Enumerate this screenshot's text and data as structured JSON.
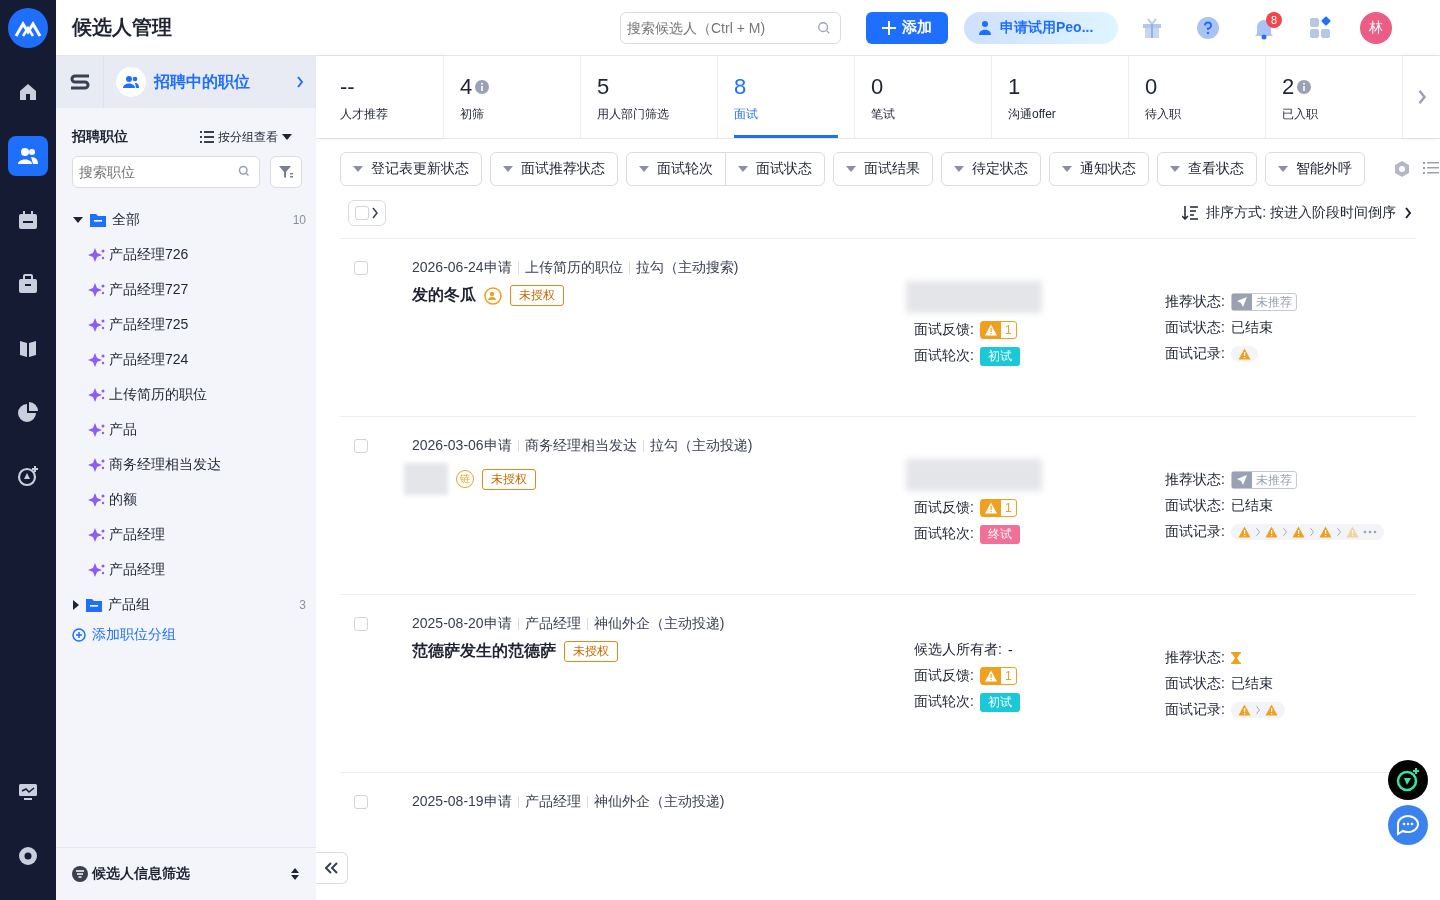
{
  "header": {
    "title": "候选人管理",
    "search": {
      "placeholder": "搜索候选人（Ctrl + M)"
    },
    "add_button": "添加",
    "trial_button": "申请试用Peo...",
    "notifications_badge": "8",
    "avatar": "林"
  },
  "nav": [
    {
      "selected": false
    },
    {
      "selected": true
    },
    {
      "selected": false
    },
    {
      "selected": false
    },
    {
      "selected": false
    },
    {
      "selected": false
    },
    {
      "selected": false
    }
  ],
  "sidebar": {
    "view_title": "招聘中的职位",
    "section_title": "招聘职位",
    "view_mode": "按分组查看",
    "search": {
      "placeholder": "搜索职位"
    },
    "groups": [
      {
        "label": "全部",
        "count": "10",
        "expanded": true,
        "children": [
          {
            "label": "产品经理726"
          },
          {
            "label": "产品经理727"
          },
          {
            "label": "产品经理725"
          },
          {
            "label": "产品经理724"
          },
          {
            "label": "上传简历的职位"
          },
          {
            "label": "产品"
          },
          {
            "label": "商务经理相当发达"
          },
          {
            "label": "的额"
          },
          {
            "label": "产品经理"
          },
          {
            "label": "产品经理"
          }
        ]
      },
      {
        "label": "产品组",
        "count": "3",
        "expanded": false
      }
    ],
    "add_group": "添加职位分组",
    "footer": "候选人信息筛选"
  },
  "stages": [
    {
      "count": "--",
      "label": "人才推荐",
      "info": false,
      "selected": false
    },
    {
      "count": "4",
      "label": "初筛",
      "info": true,
      "selected": false
    },
    {
      "count": "5",
      "label": "用人部门筛选",
      "info": false,
      "selected": false
    },
    {
      "count": "8",
      "label": "面试",
      "info": false,
      "selected": true
    },
    {
      "count": "0",
      "label": "笔试",
      "info": false,
      "selected": false
    },
    {
      "count": "1",
      "label": "沟通offer",
      "info": false,
      "selected": false
    },
    {
      "count": "0",
      "label": "待入职",
      "info": false,
      "selected": false
    },
    {
      "count": "2",
      "label": "已入职",
      "info": true,
      "selected": false
    }
  ],
  "filters": [
    [
      "登记表更新状态"
    ],
    [
      "面试推荐状态"
    ],
    [
      "面试轮次",
      "面试状态"
    ],
    [
      "面试结果"
    ],
    [
      "待定状态"
    ],
    [
      "通知状态"
    ],
    [
      "查看状态"
    ],
    [
      "智能外呼"
    ]
  ],
  "sort": {
    "label": "排序方式: 按进入阶段时间倒序"
  },
  "select_all": {
    "checked": false
  },
  "candidates": [
    {
      "selected": false,
      "date": "2026-06-24申请",
      "position": "上传简历的职位",
      "source": "拉勾（主动搜索)",
      "name": "发的冬瓜",
      "owner_icon": true,
      "tag": "未授权",
      "redacted_line": true,
      "fields": {
        "feedback_label": "面试反馈:",
        "feedback_count": "1",
        "round_label": "面试轮次:",
        "round": {
          "label": "初试",
          "kind": "first"
        },
        "recommend_label": "推荐状态:",
        "recommend": {
          "kind": "not_recommended",
          "label": "未推荐"
        },
        "status_label": "面试状态:",
        "status": "已结束",
        "records_label": "面试记录:",
        "records": [
          {
            "kind": "warning"
          }
        ],
        "more": false
      }
    },
    {
      "selected": false,
      "date": "2026-03-06申请",
      "position": "商务经理相当发达",
      "source": "拉勾（主动投递)",
      "redacted_name": true,
      "owner_icon": false,
      "name_badge": "链",
      "tag": "未授权",
      "redacted_line": true,
      "fields": {
        "feedback_label": "面试反馈:",
        "feedback_count": "1",
        "round_label": "面试轮次:",
        "round": {
          "label": "终试",
          "kind": "final"
        },
        "recommend_label": "推荐状态:",
        "recommend": {
          "kind": "not_recommended",
          "label": "未推荐"
        },
        "status_label": "面试状态:",
        "status": "已结束",
        "records_label": "面试记录:",
        "records": [
          {
            "kind": "warning"
          },
          {
            "kind": "warning"
          },
          {
            "kind": "warning"
          },
          {
            "kind": "warning"
          },
          {
            "kind": "warning_faded"
          }
        ],
        "more": true
      }
    },
    {
      "selected": false,
      "date": "2025-08-20申请",
      "position": "产品经理",
      "source": "神仙外企（主动投递)",
      "name": "范德萨发生的范德萨",
      "owner_icon": false,
      "tag": "未授权",
      "owner_label": "候选人所有者:",
      "owner": "-",
      "fields": {
        "feedback_label": "面试反馈:",
        "feedback_count": "1",
        "round_label": "面试轮次:",
        "round": {
          "label": "初试",
          "kind": "first"
        },
        "recommend_label": "推荐状态:",
        "recommend": {
          "kind": "pending"
        },
        "status_label": "面试状态:",
        "status": "已结束",
        "records_label": "面试记录:",
        "records": [
          {
            "kind": "warning"
          },
          {
            "kind": "warning"
          }
        ],
        "more": false
      }
    },
    {
      "selected": false,
      "date": "2025-08-19申请",
      "position": "产品经理",
      "source": "神仙外企（主动投递)"
    }
  ]
}
